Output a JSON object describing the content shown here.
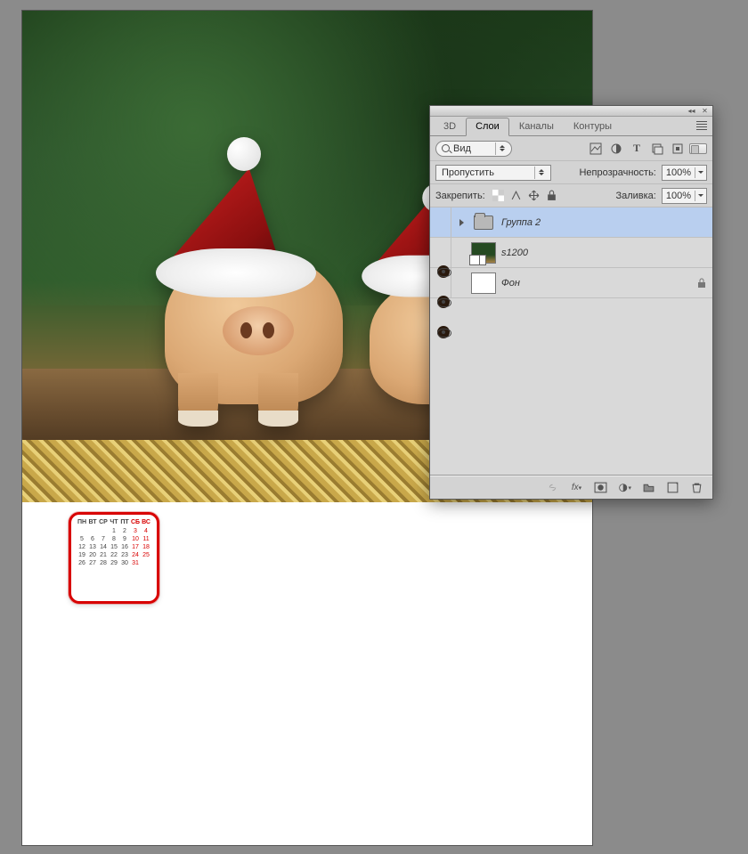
{
  "panel": {
    "tabs": [
      "3D",
      "Слои",
      "Каналы",
      "Контуры"
    ],
    "active_tab": "Слои",
    "filter_label": "Вид",
    "blend_mode": "Пропустить",
    "opacity_label": "Непрозрачность:",
    "opacity_value": "100%",
    "lock_label": "Закрепить:",
    "fill_label": "Заливка:",
    "fill_value": "100%",
    "footer_fx": "fx"
  },
  "layers": [
    {
      "name": "Группа 2",
      "kind": "group",
      "visible": true,
      "selected": true,
      "locked": false
    },
    {
      "name": "s1200",
      "kind": "image",
      "visible": true,
      "selected": false,
      "locked": false
    },
    {
      "name": "Фон",
      "kind": "solid",
      "visible": true,
      "selected": false,
      "locked": true
    }
  ],
  "calendar": {
    "headers": [
      "ПН",
      "ВТ",
      "СР",
      "ЧТ",
      "ПТ",
      "СБ",
      "ВС"
    ],
    "weeks": [
      [
        "",
        "",
        "",
        "1",
        "2",
        "3",
        "4"
      ],
      [
        "5",
        "6",
        "7",
        "8",
        "9",
        "10",
        "11"
      ],
      [
        "12",
        "13",
        "14",
        "15",
        "16",
        "17",
        "18"
      ],
      [
        "19",
        "20",
        "21",
        "22",
        "23",
        "24",
        "25"
      ],
      [
        "26",
        "27",
        "28",
        "29",
        "30",
        "31",
        ""
      ]
    ]
  }
}
